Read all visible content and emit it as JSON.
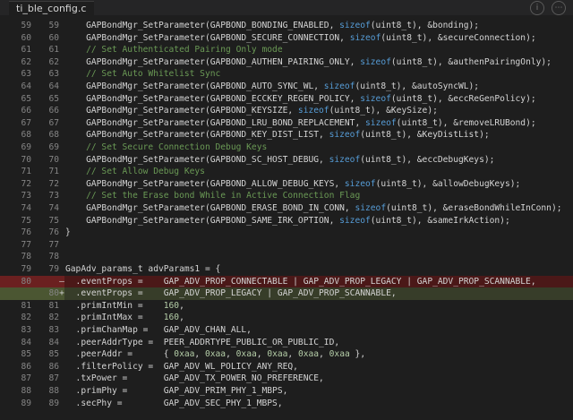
{
  "tab": {
    "filename": "ti_ble_config.c"
  },
  "lines": [
    {
      "old": "59",
      "new": "59",
      "mk": "",
      "kind": "ctx",
      "tokens": [
        [
          "p",
          "    GAPBondMgr_SetParameter(GAPBOND_BONDING_ENABLED, "
        ],
        [
          "k",
          "sizeof"
        ],
        [
          "p",
          "(uint8_t), &bonding);"
        ]
      ]
    },
    {
      "old": "60",
      "new": "60",
      "mk": "",
      "kind": "ctx",
      "tokens": [
        [
          "p",
          "    GAPBondMgr_SetParameter(GAPBOND_SECURE_CONNECTION, "
        ],
        [
          "k",
          "sizeof"
        ],
        [
          "p",
          "(uint8_t), &secureConnection);"
        ]
      ]
    },
    {
      "old": "61",
      "new": "61",
      "mk": "",
      "kind": "ctx",
      "tokens": [
        [
          "c",
          "    // Set Authenticated Pairing Only mode"
        ]
      ]
    },
    {
      "old": "62",
      "new": "62",
      "mk": "",
      "kind": "ctx",
      "tokens": [
        [
          "p",
          "    GAPBondMgr_SetParameter(GAPBOND_AUTHEN_PAIRING_ONLY, "
        ],
        [
          "k",
          "sizeof"
        ],
        [
          "p",
          "(uint8_t), &authenPairingOnly);"
        ]
      ]
    },
    {
      "old": "63",
      "new": "63",
      "mk": "",
      "kind": "ctx",
      "tokens": [
        [
          "c",
          "    // Set Auto Whitelist Sync"
        ]
      ]
    },
    {
      "old": "64",
      "new": "64",
      "mk": "",
      "kind": "ctx",
      "tokens": [
        [
          "p",
          "    GAPBondMgr_SetParameter(GAPBOND_AUTO_SYNC_WL, "
        ],
        [
          "k",
          "sizeof"
        ],
        [
          "p",
          "(uint8_t), &autoSyncWL);"
        ]
      ]
    },
    {
      "old": "65",
      "new": "65",
      "mk": "",
      "kind": "ctx",
      "tokens": [
        [
          "p",
          "    GAPBondMgr_SetParameter(GAPBOND_ECCKEY_REGEN_POLICY, "
        ],
        [
          "k",
          "sizeof"
        ],
        [
          "p",
          "(uint8_t), &eccReGenPolicy);"
        ]
      ]
    },
    {
      "old": "66",
      "new": "66",
      "mk": "",
      "kind": "ctx",
      "tokens": [
        [
          "p",
          "    GAPBondMgr_SetParameter(GAPBOND_KEYSIZE, "
        ],
        [
          "k",
          "sizeof"
        ],
        [
          "p",
          "(uint8_t), &KeySize);"
        ]
      ]
    },
    {
      "old": "67",
      "new": "67",
      "mk": "",
      "kind": "ctx",
      "tokens": [
        [
          "p",
          "    GAPBondMgr_SetParameter(GAPBOND_LRU_BOND_REPLACEMENT, "
        ],
        [
          "k",
          "sizeof"
        ],
        [
          "p",
          "(uint8_t), &removeLRUBond);"
        ]
      ]
    },
    {
      "old": "68",
      "new": "68",
      "mk": "",
      "kind": "ctx",
      "tokens": [
        [
          "p",
          "    GAPBondMgr_SetParameter(GAPBOND_KEY_DIST_LIST, "
        ],
        [
          "k",
          "sizeof"
        ],
        [
          "p",
          "(uint8_t), &KeyDistList);"
        ]
      ]
    },
    {
      "old": "69",
      "new": "69",
      "mk": "",
      "kind": "ctx",
      "tokens": [
        [
          "c",
          "    // Set Secure Connection Debug Keys"
        ]
      ]
    },
    {
      "old": "70",
      "new": "70",
      "mk": "",
      "kind": "ctx",
      "tokens": [
        [
          "p",
          "    GAPBondMgr_SetParameter(GAPBOND_SC_HOST_DEBUG, "
        ],
        [
          "k",
          "sizeof"
        ],
        [
          "p",
          "(uint8_t), &eccDebugKeys);"
        ]
      ]
    },
    {
      "old": "71",
      "new": "71",
      "mk": "",
      "kind": "ctx",
      "tokens": [
        [
          "c",
          "    // Set Allow Debug Keys"
        ]
      ]
    },
    {
      "old": "72",
      "new": "72",
      "mk": "",
      "kind": "ctx",
      "tokens": [
        [
          "p",
          "    GAPBondMgr_SetParameter(GAPBOND_ALLOW_DEBUG_KEYS, "
        ],
        [
          "k",
          "sizeof"
        ],
        [
          "p",
          "(uint8_t), &allowDebugKeys);"
        ]
      ]
    },
    {
      "old": "73",
      "new": "73",
      "mk": "",
      "kind": "ctx",
      "tokens": [
        [
          "c",
          "    // Set the Erase bond While in Active Connection Flag"
        ]
      ]
    },
    {
      "old": "74",
      "new": "74",
      "mk": "",
      "kind": "ctx",
      "tokens": [
        [
          "p",
          "    GAPBondMgr_SetParameter(GAPBOND_ERASE_BOND_IN_CONN, "
        ],
        [
          "k",
          "sizeof"
        ],
        [
          "p",
          "(uint8_t), &eraseBondWhileInConn);"
        ]
      ]
    },
    {
      "old": "75",
      "new": "75",
      "mk": "",
      "kind": "ctx",
      "tokens": [
        [
          "p",
          "    GAPBondMgr_SetParameter(GAPBOND_SAME_IRK_OPTION, "
        ],
        [
          "k",
          "sizeof"
        ],
        [
          "p",
          "(uint8_t), &sameIrkAction);"
        ]
      ]
    },
    {
      "old": "76",
      "new": "76",
      "mk": "",
      "kind": "ctx",
      "tokens": [
        [
          "p",
          "}"
        ]
      ]
    },
    {
      "old": "77",
      "new": "77",
      "mk": "",
      "kind": "ctx",
      "tokens": [
        [
          "p",
          ""
        ]
      ]
    },
    {
      "old": "78",
      "new": "78",
      "mk": "",
      "kind": "ctx",
      "tokens": [
        [
          "p",
          ""
        ]
      ]
    },
    {
      "old": "79",
      "new": "79",
      "mk": "",
      "kind": "ctx",
      "tokens": [
        [
          "p",
          "GapAdv_params_t advParams1 = {"
        ]
      ]
    },
    {
      "old": "80",
      "new": "",
      "mk": "—",
      "kind": "del",
      "tokens": [
        [
          "p",
          "  .eventProps =    GAP_ADV_PROP_CONNECTABLE | GAP_ADV_PROP_LEGACY | GAP_ADV_PROP_SCANNABLE,"
        ]
      ]
    },
    {
      "old": "",
      "new": "80",
      "mk": "+",
      "kind": "add",
      "tokens": [
        [
          "p",
          "  .eventProps =    GAP_ADV_PROP_LEGACY | GAP_ADV_PROP_SCANNABLE,"
        ]
      ]
    },
    {
      "old": "81",
      "new": "81",
      "mk": "",
      "kind": "ctx",
      "tokens": [
        [
          "p",
          "  .primIntMin =    "
        ],
        [
          "n",
          "160"
        ],
        [
          "p",
          ","
        ]
      ]
    },
    {
      "old": "82",
      "new": "82",
      "mk": "",
      "kind": "ctx",
      "tokens": [
        [
          "p",
          "  .primIntMax =    "
        ],
        [
          "n",
          "160"
        ],
        [
          "p",
          ","
        ]
      ]
    },
    {
      "old": "83",
      "new": "83",
      "mk": "",
      "kind": "ctx",
      "tokens": [
        [
          "p",
          "  .primChanMap =   GAP_ADV_CHAN_ALL,"
        ]
      ]
    },
    {
      "old": "84",
      "new": "84",
      "mk": "",
      "kind": "ctx",
      "tokens": [
        [
          "p",
          "  .peerAddrType =  PEER_ADDRTYPE_PUBLIC_OR_PUBLIC_ID,"
        ]
      ]
    },
    {
      "old": "85",
      "new": "85",
      "mk": "",
      "kind": "ctx",
      "tokens": [
        [
          "p",
          "  .peerAddr =      { "
        ],
        [
          "n",
          "0xaa"
        ],
        [
          "p",
          ", "
        ],
        [
          "n",
          "0xaa"
        ],
        [
          "p",
          ", "
        ],
        [
          "n",
          "0xaa"
        ],
        [
          "p",
          ", "
        ],
        [
          "n",
          "0xaa"
        ],
        [
          "p",
          ", "
        ],
        [
          "n",
          "0xaa"
        ],
        [
          "p",
          ", "
        ],
        [
          "n",
          "0xaa"
        ],
        [
          "p",
          " },"
        ]
      ]
    },
    {
      "old": "86",
      "new": "86",
      "mk": "",
      "kind": "ctx",
      "tokens": [
        [
          "p",
          "  .filterPolicy =  GAP_ADV_WL_POLICY_ANY_REQ,"
        ]
      ]
    },
    {
      "old": "87",
      "new": "87",
      "mk": "",
      "kind": "ctx",
      "tokens": [
        [
          "p",
          "  .txPower =       GAP_ADV_TX_POWER_NO_PREFERENCE,"
        ]
      ]
    },
    {
      "old": "88",
      "new": "88",
      "mk": "",
      "kind": "ctx",
      "tokens": [
        [
          "p",
          "  .primPhy =       GAP_ADV_PRIM_PHY_1_MBPS,"
        ]
      ]
    },
    {
      "old": "89",
      "new": "89",
      "mk": "",
      "kind": "ctx",
      "tokens": [
        [
          "p",
          "  .secPhy =        GAP_ADV_SEC_PHY_1_MBPS,"
        ]
      ]
    }
  ]
}
